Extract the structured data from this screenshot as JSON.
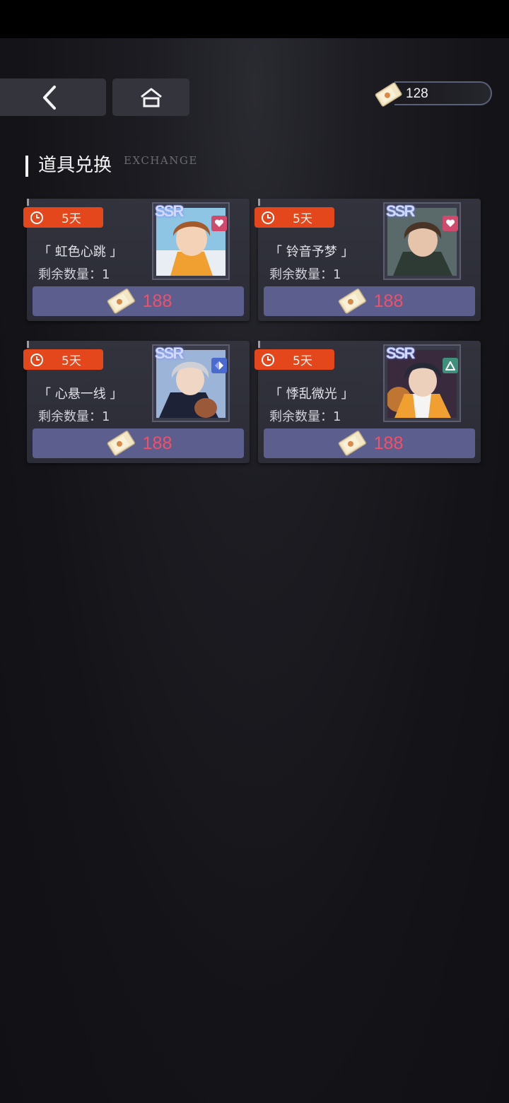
{
  "currency": {
    "value": "128",
    "icon": "ticket-icon"
  },
  "section": {
    "title": "道具兑换",
    "subtitle": "EXCHANGE"
  },
  "cards": [
    {
      "timer": "5天",
      "name": "「 虹色心跳 」",
      "remaining": "剩余数量：1",
      "rarity": "SSR",
      "type_icon": "heart-icon",
      "price": "188"
    },
    {
      "timer": "5天",
      "name": "「 铃音予梦 」",
      "remaining": "剩余数量：1",
      "rarity": "SSR",
      "type_icon": "heart-icon",
      "price": "188"
    },
    {
      "timer": "5天",
      "name": "「 心悬一线 」",
      "remaining": "剩余数量：1",
      "rarity": "SSR",
      "type_icon": "diamond-icon",
      "price": "188"
    },
    {
      "timer": "5天",
      "name": "「 悸乱微光 」",
      "remaining": "剩余数量：1",
      "rarity": "SSR",
      "type_icon": "triangle-icon",
      "price": "188"
    }
  ],
  "colors": {
    "timer": "#e4471c",
    "price_text": "#f0506a",
    "price_bar": "#5c5e8e",
    "heart_badge": "#d04a6e",
    "diamond_badge": "#4a6ad0",
    "triangle_badge": "#3f8f7a"
  }
}
